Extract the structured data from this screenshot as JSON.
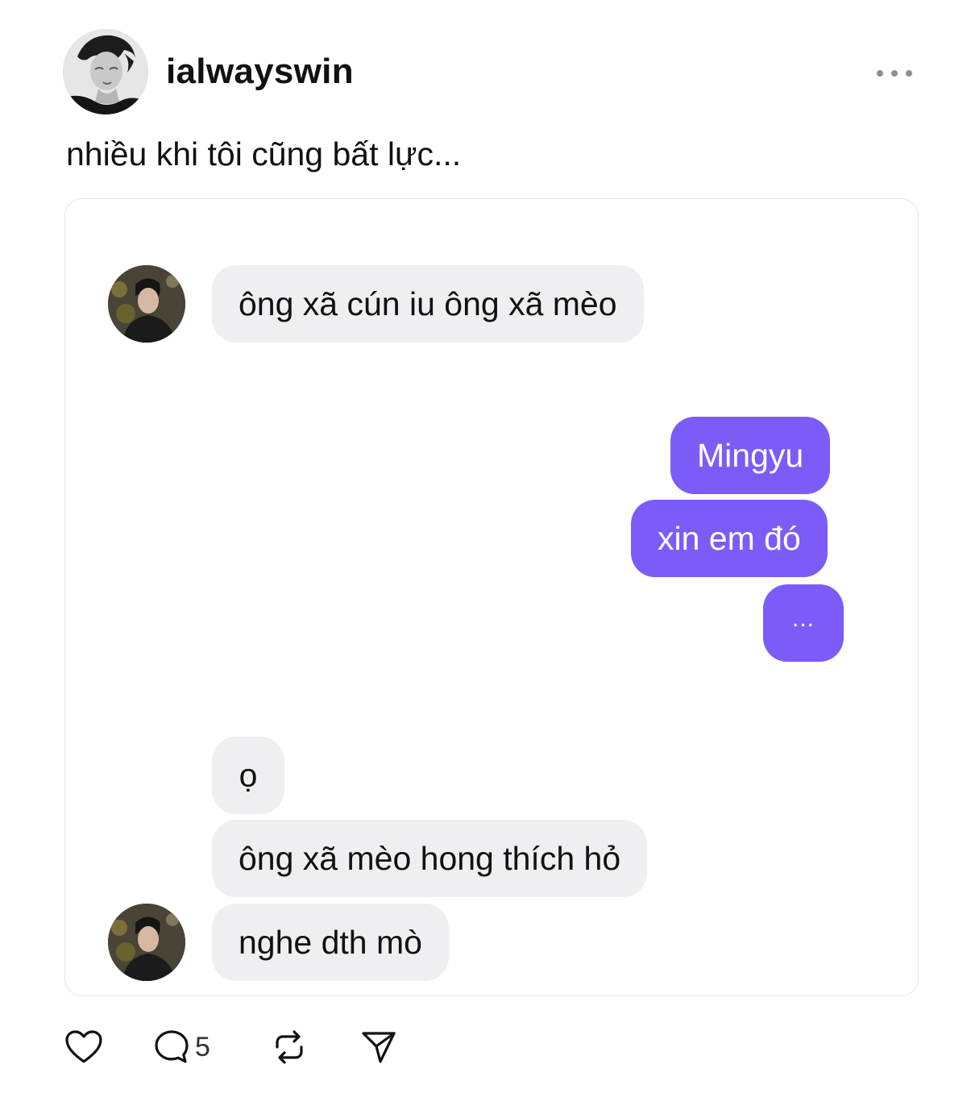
{
  "post": {
    "username": "ialwayswin",
    "caption": "nhiều khi tôi cũng bất lực..."
  },
  "chat": {
    "messages": [
      {
        "side": "in",
        "text": "ông xã cún iu ông xã mèo"
      },
      {
        "side": "out",
        "text": "Mingyu"
      },
      {
        "side": "out",
        "text": "xin em đó"
      },
      {
        "side": "out",
        "text": "..."
      },
      {
        "side": "in",
        "text": "ọ"
      },
      {
        "side": "in",
        "text": "ông xã mèo hong thích hỏ"
      },
      {
        "side": "in",
        "text": "nghe dth mò"
      }
    ],
    "colors": {
      "outgoing_bubble": "#7b5cf8",
      "incoming_bubble": "#efeff2"
    }
  },
  "actions": {
    "like_icon": "heart-icon",
    "comment_icon": "comment-bubble-icon",
    "comment_count": "5",
    "repost_icon": "repost-icon",
    "share_icon": "send-icon"
  },
  "header": {
    "more_icon": "more-dots-icon"
  }
}
